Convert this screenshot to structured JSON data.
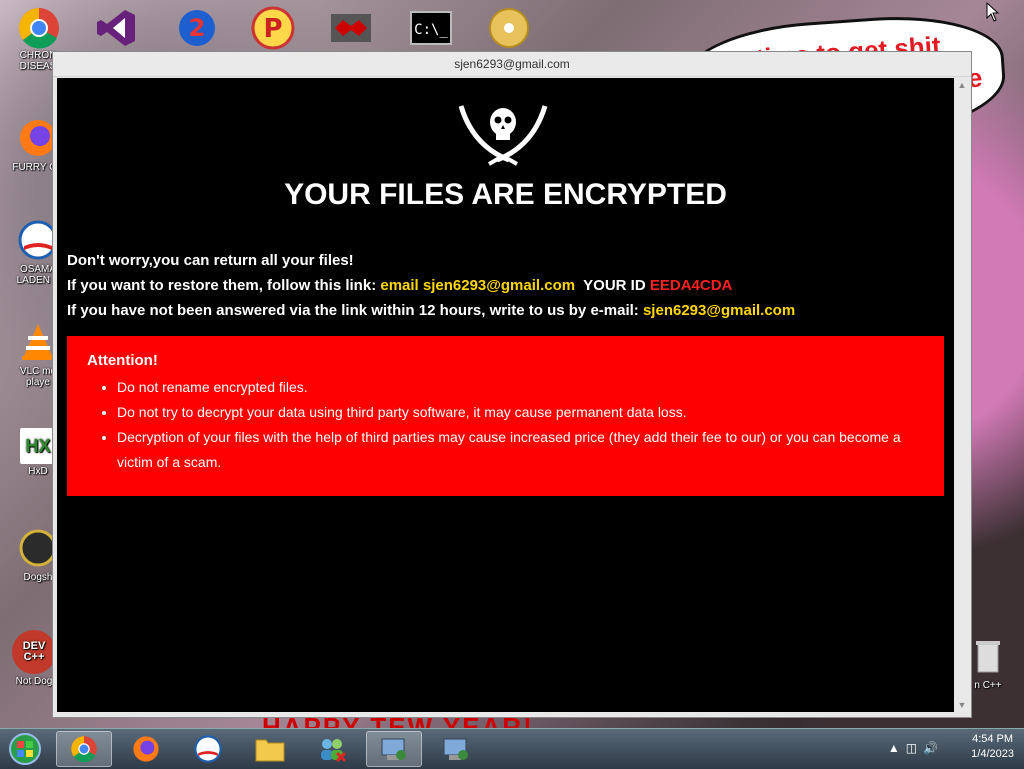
{
  "desktop": {
    "icons": [
      {
        "label": "CHRON DISEAS"
      },
      {
        "label": "FURRY CU"
      },
      {
        "label": "OSAMA LADEN B"
      },
      {
        "label": "VLC me playe"
      },
      {
        "label": "HxD"
      },
      {
        "label": "Dogsh"
      },
      {
        "label": "Not Dog"
      }
    ],
    "right_icon_label": "n C++",
    "speech_text": "it's time to get shit",
    "speech_text2": "te",
    "banner_text": "HAPPY TEW YEAR!"
  },
  "window": {
    "title": "sjen6293@gmail.com"
  },
  "ransom": {
    "heading": "YOUR FILES ARE ENCRYPTED",
    "line1": "Don't worry,you can return all your files!",
    "line2_prefix": "If you want to restore them, follow this link:",
    "line2_email": "email sjen6293@gmail.com",
    "line2_id_label": "YOUR ID",
    "line2_id": "EEDA4CDA",
    "line3_prefix": "If you have not been answered via the link within 12 hours, write to us by e-mail:",
    "line3_email": "sjen6293@gmail.com",
    "attention_title": "Attention!",
    "bullets": [
      "Do not rename encrypted files.",
      "Do not try to decrypt your data using third party software, it may cause permanent data loss.",
      "Decryption of your files with the help of third parties may cause increased price (they add their fee to our) or you can become a victim of a scam."
    ]
  },
  "taskbar": {
    "time": "4:54 PM",
    "date": "1/4/2023"
  }
}
